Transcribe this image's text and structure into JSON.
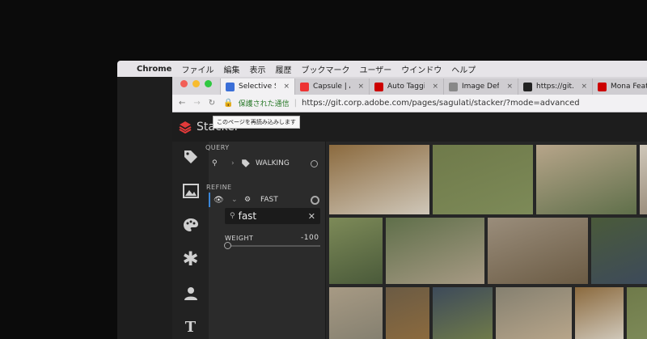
{
  "menubar": {
    "apple": "",
    "app": "Chrome",
    "items": [
      "ファイル",
      "編集",
      "表示",
      "履歴",
      "ブックマーク",
      "ユーザー",
      "ウインドウ",
      "ヘルプ"
    ]
  },
  "tabs": [
    {
      "label": "Selective Simil",
      "color": "#3b6fd8",
      "active": true
    },
    {
      "label": "Capsule | Adob",
      "color": "#e33",
      "active": false
    },
    {
      "label": "Auto Tagging",
      "color": "#c00",
      "active": false
    },
    {
      "label": "Image Defects",
      "color": "#888",
      "active": false
    },
    {
      "label": "https://git.corp",
      "color": "#222",
      "active": false
    },
    {
      "label": "Mona Feat",
      "color": "#c00",
      "active": false
    }
  ],
  "address": {
    "secure_label": "保護された通信",
    "url": "https://git.corp.adobe.com/pages/sagulati/stacker/?mode=advanced"
  },
  "tooltip": "このページを再読み込みします",
  "app": {
    "name": "Stacker",
    "query_heading": "QUERY",
    "query_term": "WALKING",
    "refine_heading": "REFINE",
    "refine_term": "FAST",
    "search_value": "fast",
    "weight_label": "WEIGHT",
    "weight_value": "-100"
  },
  "colors": {
    "photo_tones": [
      "#8b6a3e",
      "#6f7a4a",
      "#b7a58a",
      "#cfc7b9",
      "#7d8a58",
      "#5f6f4a",
      "#9a8d7b",
      "#4a5a3a",
      "#a79a84",
      "#6b5b44",
      "#3d4a5a",
      "#858070"
    ]
  }
}
